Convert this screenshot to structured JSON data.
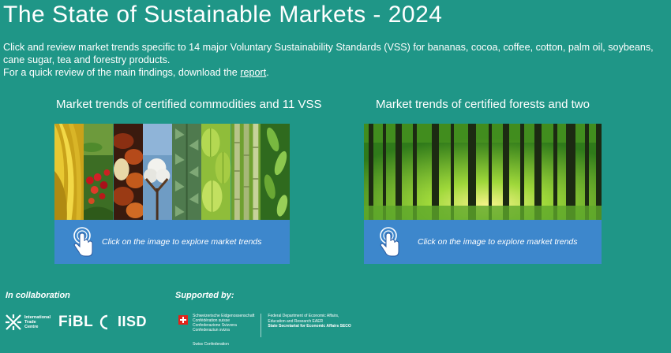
{
  "page": {
    "title": "The State of Sustainable Markets - 2024",
    "intro_line1": "Click and review market trends specific to 14 major Voluntary Sustainability Standards (VSS) for bananas, cocoa, coffee, cotton, palm oil, soybeans, cane sugar, tea and forestry products.",
    "intro_line2_prefix": "For a quick review of the main findings, download the ",
    "intro_link": "report",
    "intro_line2_suffix": "."
  },
  "cards": {
    "commodities": {
      "title": "Market trends of certified commodities and 11 VSS",
      "cta": "Click on the image to explore market trends",
      "strips": [
        "bananas",
        "coffee",
        "cocoa",
        "cotton",
        "palm-oil",
        "soybeans",
        "cane-sugar",
        "tea"
      ]
    },
    "forests": {
      "title": "Market trends of certified forests and two",
      "cta": "Click on the image to explore market trends"
    }
  },
  "footer": {
    "collab_label": "In collaboration",
    "supported_label": "Supported by:",
    "itc_text": [
      "International",
      "Trade",
      "Centre"
    ],
    "fibl": "FiBL",
    "iisd": "IISD",
    "swiss_names": [
      "Schweizerische Eidgenossenschaft",
      "Confédération suisse",
      "Confederazione Svizzera",
      "Confederaziun svizra"
    ],
    "swiss_dept": [
      "Federal Department of Economic Affairs,",
      "Education and Research EAER",
      "State Secretariat for Economic Affairs SECO"
    ],
    "swiss_confed": "Swiss Confederation"
  },
  "colors": {
    "background": "#1f9687",
    "overlay": "#4285d6",
    "swiss_red": "#e2231a"
  },
  "icons": {
    "hand_pointer": "hand-pointer-icon",
    "swiss_flag": "swiss-flag-icon"
  }
}
